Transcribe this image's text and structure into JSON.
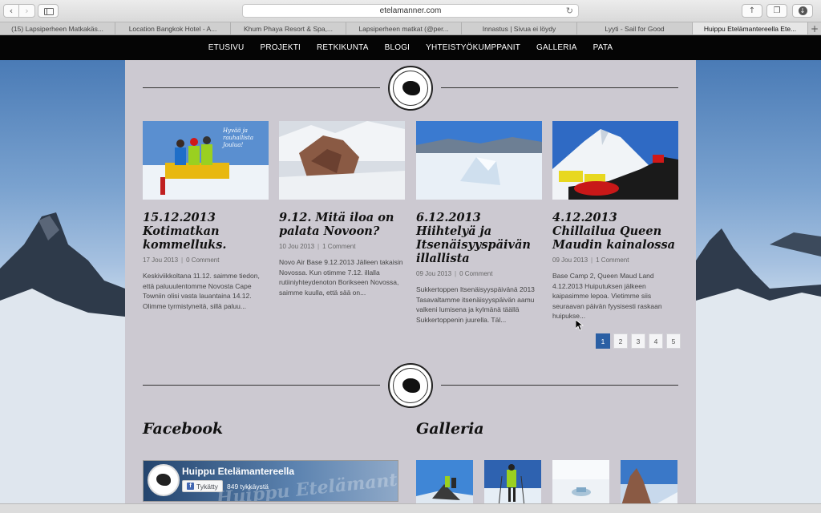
{
  "browser": {
    "url": "etelamanner.com",
    "tabs": [
      {
        "label": "(15) Lapsiperheen Matkakäs...",
        "active": false
      },
      {
        "label": "Location Bangkok Hotel - A...",
        "active": false
      },
      {
        "label": "Khum Phaya Resort & Spa,...",
        "active": false
      },
      {
        "label": "Lapsiperheen matkat (@per...",
        "active": false
      },
      {
        "label": "Innastus | Sivua ei löydy",
        "active": false
      },
      {
        "label": "Lyyti - Sail for Good",
        "active": false
      },
      {
        "label": "Huippu Etelämantereella Ete...",
        "active": true
      }
    ],
    "new_tab": "+"
  },
  "nav": {
    "items": [
      "ETUSIVU",
      "PROJEKTI",
      "RETKIKUNTA",
      "BLOGI",
      "YHTEISTYÖKUMPPANIT",
      "GALLERIA",
      "PATA"
    ]
  },
  "posts": [
    {
      "title": "15.12.2013 Kotimatkan kommelluks.",
      "date": "17 Jou 2013",
      "comments": "0 Comment",
      "excerpt": "Keskiviikkoltana 11.12. saimme tiedon, että paluuulentomme Novosta Cape Towniin olisi vasta lauantaina 14.12. Olimme tyrmistyneitä, sillä paluu...",
      "thumb_overlay": "Hyvää ja rauhallista Joulua!"
    },
    {
      "title": "9.12. Mitä iloa on palata Novoon?",
      "date": "10 Jou 2013",
      "comments": "1 Comment",
      "excerpt": "Novo Air Base 9.12.2013 Jälleen takaisin Novossa. Kun otimme 7.12. illalla rutiiniyhteydenoton Borikseen Novossa, saimme kuulla, että sää on..."
    },
    {
      "title": "6.12.2013 Hiihtelyä ja Itsenäisyyspäivän illallista",
      "date": "09 Jou 2013",
      "comments": "0 Comment",
      "excerpt": "Sukkertoppen Itsenäisyyspäivänä 2013 Tasavaltamme itsenäisyyspäivän aamu valkeni lumisena ja kylmänä täällä Sukkertoppenin juurella. Täl..."
    },
    {
      "title": "4.12.2013 Chillailua Queen Maudin kainalossa",
      "date": "09 Jou 2013",
      "comments": "1 Comment",
      "excerpt": "Base Camp 2, Queen Maud Land 4.12.2013 Huiputuksen jälkeen kaipasimme lepoa. Vietimme siis seuraavan päivän fyysisesti raskaan huipukse..."
    }
  ],
  "pagination": {
    "pages": [
      "1",
      "2",
      "3",
      "4",
      "5"
    ],
    "current": "1"
  },
  "sections": {
    "facebook": "Facebook",
    "gallery": "Galleria"
  },
  "facebook_widget": {
    "page_name": "Huippu Etelämantereella",
    "like_label": "Tykätty",
    "likes": "849 tykkäystä",
    "watermark": "Huippu Etelämantereella"
  },
  "colors": {
    "nav_bg": "#050505",
    "content_bg": "#ccc9d1",
    "pager_active": "#2a5fa4"
  }
}
